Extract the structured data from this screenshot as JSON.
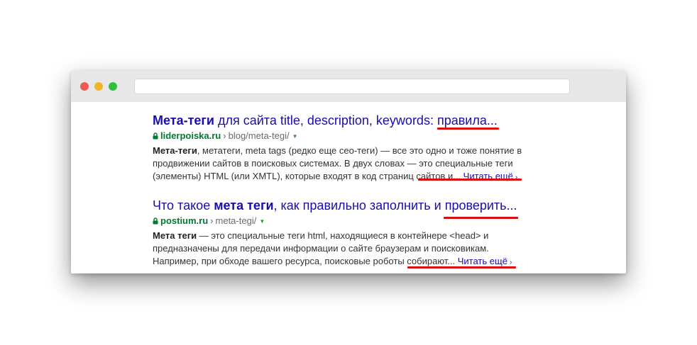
{
  "window": {
    "controls": [
      "close",
      "minimize",
      "maximize"
    ],
    "address_bar": ""
  },
  "results": [
    {
      "title_bold": "Мета-теги",
      "title_rest": " для сайта title, description, keywords: правила...",
      "domain": "liderpoiska.ru",
      "separator": "›",
      "path": "blog/meta-tegi/",
      "dropdown": "▼",
      "snippet_bold": "Мета-теги",
      "snippet_rest": ", метатеги, meta tags (редко еще сео-теги) — все это одно и тоже понятие в продвижении сайтов в поисковых системах. В двух словах — это специальные теги (элементы) HTML (или XMTL), которые входят в код страниц сайтов и... ",
      "more_label": "Читать ещё",
      "more_chevron": "›"
    },
    {
      "title_pre": "Что такое ",
      "title_bold": "мета теги",
      "title_rest": ", как правильно заполнить и проверить...",
      "domain": "postium.ru",
      "separator": "›",
      "path": "meta-tegi/",
      "dropdown": "▼",
      "snippet_bold": "Мета теги",
      "snippet_rest": " — это специальные теги html, находящиеся в контейнере <head> и предназначены для передачи информации о сайте браузерам и поисковикам. Например, при обходе вашего ресурса, поисковые роботы собирают... ",
      "more_label": "Читать ещё",
      "more_chevron": "›"
    }
  ],
  "colors": {
    "title_link": "#1a0dab",
    "domain_green": "#007a2e",
    "underline_red": "#d90d0d",
    "titlebar": "#e8e8e8"
  }
}
